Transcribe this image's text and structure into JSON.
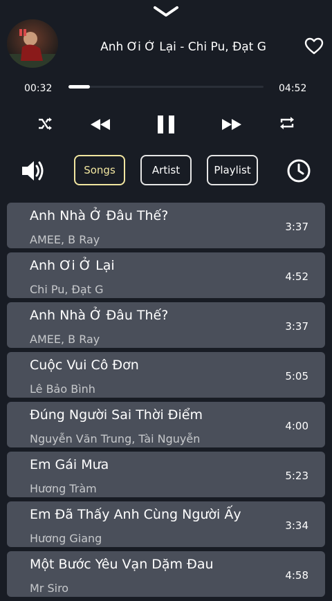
{
  "player": {
    "now_playing": "Anh Ơi Ở Lại - Chi Pu, Đạt G",
    "current_time": "00:32",
    "duration": "04:52",
    "progress": 0.11,
    "icons": [
      "chevron-down-icon",
      "heart-icon",
      "shuffle-icon",
      "rewind-icon",
      "pause-icon",
      "fast-forward-icon",
      "repeat-icon",
      "volume-icon",
      "clock-icon"
    ]
  },
  "tabs": [
    {
      "label": "Songs",
      "active": true
    },
    {
      "label": "Artist",
      "active": false
    },
    {
      "label": "Playlist",
      "active": false
    }
  ],
  "songs": [
    {
      "title": "Anh Nhà Ở Đâu Thế?",
      "artist": "AMEE, B Ray",
      "duration": "3:37"
    },
    {
      "title": "Anh Ơi Ở Lại",
      "artist": "Chi Pu, Đạt G",
      "duration": "4:52"
    },
    {
      "title": "Anh Nhà Ở Đâu Thế?",
      "artist": "AMEE, B Ray",
      "duration": "3:37"
    },
    {
      "title": "Cuộc Vui Cô Đơn",
      "artist": "Lê Bảo Bình",
      "duration": "5:05"
    },
    {
      "title": "Đúng Người Sai Thời Điểm",
      "artist": "Nguyễn Văn Trung, Tài Nguyễn",
      "duration": "4:00"
    },
    {
      "title": "Em Gái Mưa",
      "artist": "Hương Tràm",
      "duration": "5:23"
    },
    {
      "title": "Em Đã Thấy Anh Cùng Người Ấy",
      "artist": "Hương Giang",
      "duration": "3:34"
    },
    {
      "title": "Một Bước Yêu Vạn Dặm Đau",
      "artist": "Mr Siro",
      "duration": "4:58"
    }
  ],
  "colors": {
    "background": "#181c24",
    "row": "#4a4f5a",
    "accent": "#f2e6a0"
  }
}
